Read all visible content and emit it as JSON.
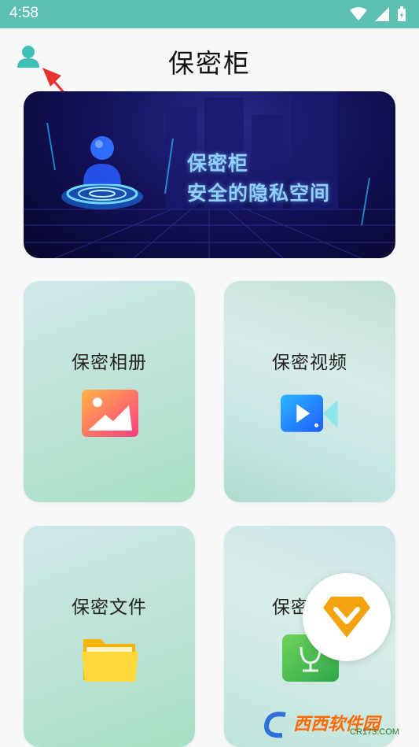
{
  "status_bar": {
    "time": "4:58"
  },
  "header": {
    "title": "保密柜"
  },
  "banner": {
    "title": "保密柜",
    "subtitle": "安全的隐私空间"
  },
  "cards": [
    {
      "label": "保密相册",
      "icon": "photo-album-icon"
    },
    {
      "label": "保密视频",
      "icon": "video-camera-icon"
    },
    {
      "label": "保密文件",
      "icon": "folder-icon"
    },
    {
      "label": "保密语音",
      "icon": "voice-icon"
    }
  ],
  "fab": {
    "icon": "diamond-vip-icon"
  },
  "watermark": {
    "text": "西西软件园",
    "sub": "CR173.COM"
  },
  "colors": {
    "status_bar": "#5cc0b3",
    "accent": "#3fc0b4",
    "vip": "#f3a310"
  }
}
